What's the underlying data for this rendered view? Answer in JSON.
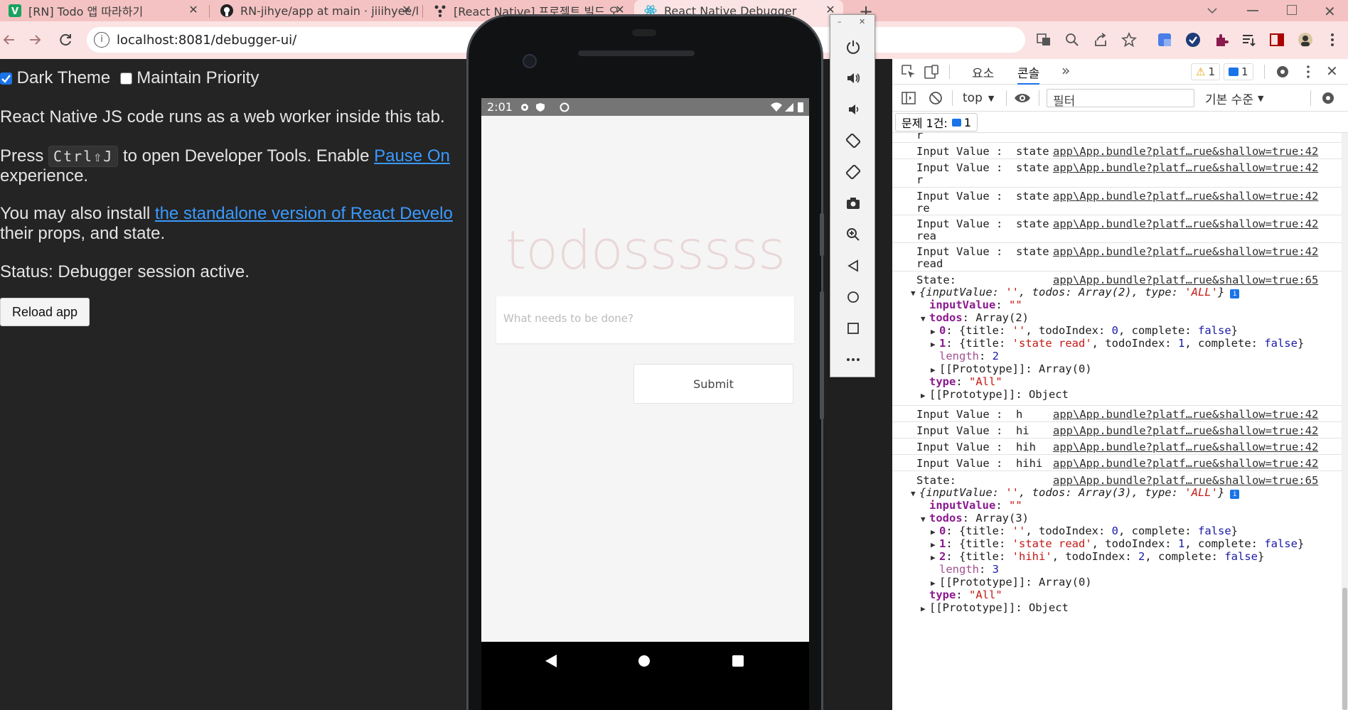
{
  "tabs": [
    {
      "title": "[RN] Todo 앱 따라하기",
      "close": "✕",
      "icon": "v-app-icon"
    },
    {
      "title": "RN-jihye/app at main · jiiihyee/l",
      "close": "✕",
      "icon": "github-icon"
    },
    {
      "title": "[React Native] 프로젝트 빌드 오",
      "close": "✕",
      "icon": "app-icon"
    },
    {
      "title": "React Native Debugger",
      "close": "✕",
      "icon": "react-icon"
    }
  ],
  "new_tab": "+",
  "address": "localhost:8081/debugger-ui/",
  "page": {
    "dark_theme_label": "Dark Theme",
    "maintain_priority_label": "Maintain Priority",
    "line1": "React Native JS code runs as a web worker inside this tab.",
    "press": "Press",
    "shortcut": "Ctrl⇧J",
    "to_open": "to open Developer Tools. Enable",
    "pause_link": "Pause On",
    "experience": "experience.",
    "install_prefix": "You may also install",
    "standalone_link": "the standalone version of React Develo",
    "props_line": "their props, and state.",
    "status": "Status: Debugger session active.",
    "reload": "Reload app"
  },
  "phone": {
    "time": "2:01",
    "app_title": "todossssss",
    "input_placeholder": "What needs to be done?",
    "submit": "Submit"
  },
  "devtools": {
    "tab_elements": "요소",
    "tab_console": "콘솔",
    "more_tabs": "»",
    "warn_count": "1",
    "info_count": "1",
    "context": "top",
    "filter_placeholder": "필터",
    "levels": "기본 수준",
    "issues_label": "문제 1건:",
    "issues_count": "1"
  },
  "console": {
    "top_fragment": "r",
    "source_42": "app\\App.bundle?platf…rue&shallow=true:42",
    "source_65": "app\\App.bundle?platf…rue&shallow=true:65",
    "logs": [
      {
        "msg": "Input Value :  state",
        "cont": ""
      },
      {
        "msg": "Input Value :  state",
        "cont": "r"
      },
      {
        "msg": "Input Value :  state",
        "cont": "re"
      },
      {
        "msg": "Input Value :  state",
        "cont": "rea"
      },
      {
        "msg": "Input Value :  state",
        "cont": "read"
      },
      {
        "msg": "Input Value :  h",
        "cont": ""
      },
      {
        "msg": "Input Value :  hi",
        "cont": ""
      },
      {
        "msg": "Input Value :  hih",
        "cont": ""
      },
      {
        "msg": "Input Value :  hihi",
        "cont": ""
      }
    ],
    "state_label": "State:",
    "state1": {
      "summary_open": "{inputValue: ",
      "summary_empty": "''",
      "summary_todos": ", todos: Array(2), type: ",
      "summary_type": "'ALL'",
      "summary_close": "}",
      "inputValue_key": "inputValue",
      "inputValue_val": "\"\"",
      "todos_key": "todos",
      "todos_val": "Array(2)",
      "items": [
        {
          "idx": "0",
          "title": "''",
          "index": "0",
          "complete": "false"
        },
        {
          "idx": "1",
          "title": "'state read'",
          "index": "1",
          "complete": "false"
        }
      ],
      "length_key": "length",
      "length_val": "2",
      "proto_array": "[[Prototype]]: Array(0)",
      "type_key": "type",
      "type_val": "\"All\"",
      "proto_object": "[[Prototype]]: Object"
    },
    "state2": {
      "summary_open": "{inputValue: ",
      "summary_empty": "''",
      "summary_todos": ", todos: Array(3), type: ",
      "summary_type": "'ALL'",
      "summary_close": "}",
      "inputValue_key": "inputValue",
      "inputValue_val": "\"\"",
      "todos_key": "todos",
      "todos_val": "Array(3)",
      "items": [
        {
          "idx": "0",
          "title": "''",
          "index": "0",
          "complete": "false"
        },
        {
          "idx": "1",
          "title": "'state read'",
          "index": "1",
          "complete": "false"
        },
        {
          "idx": "2",
          "title": "'hihi'",
          "index": "2",
          "complete": "false"
        }
      ],
      "length_key": "length",
      "length_val": "3",
      "proto_array": "[[Prototype]]: Array(0)",
      "type_key": "type",
      "type_val": "\"All\"",
      "proto_object": "[[Prototype]]: Object"
    }
  }
}
